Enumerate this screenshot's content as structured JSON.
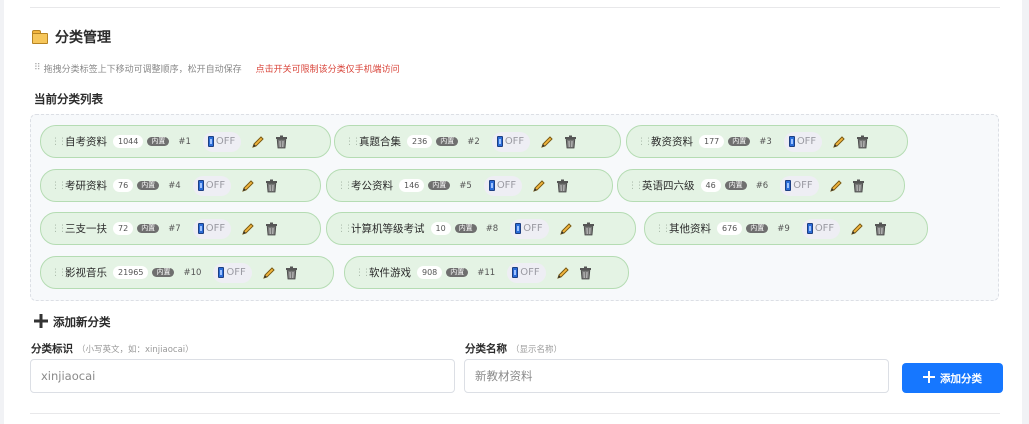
{
  "section": {
    "title": "分类管理",
    "hint": "拖拽分类标签上下移动可调整顺序，松开自动保存",
    "warning": "点击开关可限制该分类仅手机端访问",
    "list_label": "当前分类列表"
  },
  "categories": [
    {
      "name": "自考资料",
      "count": "1044",
      "badge": "内置",
      "order": "#1",
      "toggle": "OFF"
    },
    {
      "name": "真题合集",
      "count": "236",
      "badge": "内置",
      "order": "#2",
      "toggle": "OFF"
    },
    {
      "name": "教资资料",
      "count": "177",
      "badge": "内置",
      "order": "#3",
      "toggle": "OFF"
    },
    {
      "name": "考研资料",
      "count": "76",
      "badge": "内置",
      "order": "#4",
      "toggle": "OFF"
    },
    {
      "name": "考公资料",
      "count": "146",
      "badge": "内置",
      "order": "#5",
      "toggle": "OFF"
    },
    {
      "name": "英语四六级",
      "count": "46",
      "badge": "内置",
      "order": "#6",
      "toggle": "OFF"
    },
    {
      "name": "三支一扶",
      "count": "72",
      "badge": "内置",
      "order": "#7",
      "toggle": "OFF"
    },
    {
      "name": "计算机等级考试",
      "count": "10",
      "badge": "内置",
      "order": "#8",
      "toggle": "OFF"
    },
    {
      "name": "其他资料",
      "count": "676",
      "badge": "内置",
      "order": "#9",
      "toggle": "OFF"
    },
    {
      "name": "影视音乐",
      "count": "21965",
      "badge": "内置",
      "order": "#10",
      "toggle": "OFF"
    },
    {
      "name": "软件游戏",
      "count": "908",
      "badge": "内置",
      "order": "#11",
      "toggle": "OFF"
    }
  ],
  "add": {
    "title": "添加新分类",
    "key_label": "分类标识",
    "key_hint": "（小写英文，如：xinjiaocai）",
    "key_placeholder": "xinjiaocai",
    "name_label": "分类名称",
    "name_hint": "（显示名称）",
    "name_placeholder": "新教材资料",
    "button": "添加分类"
  },
  "colors": {
    "pill_bg": "#e4f3e4",
    "pill_border": "#b5dcb3",
    "accent": "#1677ff",
    "warning": "#d9453b"
  },
  "icons": [
    "folder-icon",
    "drag-handle-icon",
    "phone-icon",
    "pencil-icon",
    "trash-icon",
    "plus-icon"
  ]
}
